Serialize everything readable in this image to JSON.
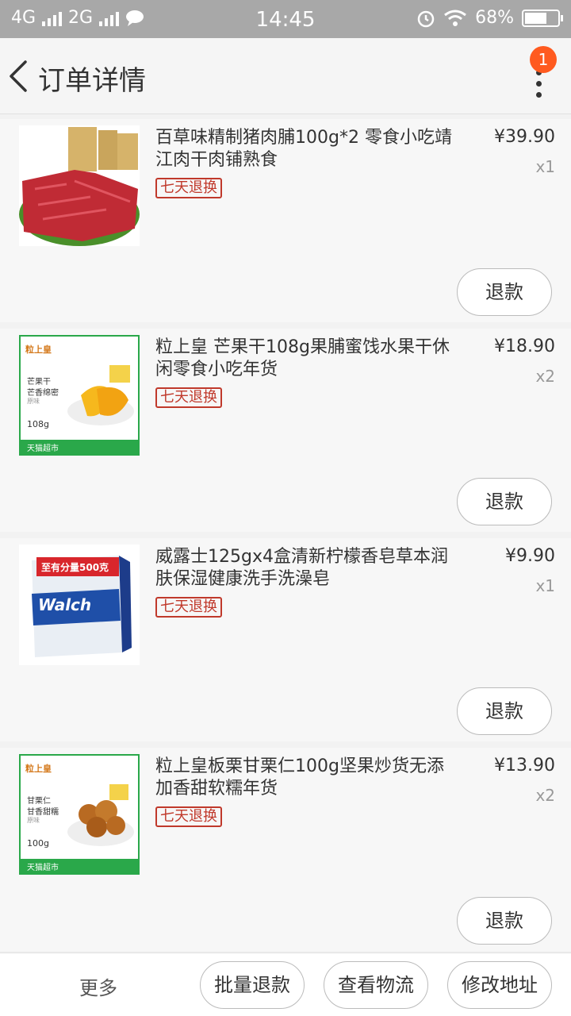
{
  "status_bar": {
    "network1": "4G",
    "network2": "2G",
    "time": "14:45",
    "battery": "68%",
    "battery_level": 0.68
  },
  "header": {
    "title": "订单详情",
    "badge_count": "1"
  },
  "items": [
    {
      "name": "百草味精制猪肉脯100g*2 零食小吃靖江肉干肉铺熟食",
      "tag": "七天退换",
      "price": "¥39.90",
      "qty": "x1",
      "refund": "退款"
    },
    {
      "name": "粒上皇 芒果干108g果脯蜜饯水果干休闲零食小吃年货",
      "tag": "七天退换",
      "price": "¥18.90",
      "qty": "x2",
      "refund": "退款",
      "thumb_brand": "粒上皇",
      "thumb_line1": "芒果干",
      "thumb_line2": "芒香绵密",
      "thumb_line3": "原味",
      "thumb_weight": "108g",
      "thumb_footer": "天猫超市"
    },
    {
      "name": "威露士125gx4盒清新柠檬香皂草本润肤保湿健康洗手洗澡皂",
      "tag": "七天退换",
      "price": "¥9.90",
      "qty": "x1",
      "refund": "退款",
      "thumb_promo": "至有分量500克",
      "thumb_brand": "Walch"
    },
    {
      "name": "粒上皇板栗甘栗仁100g坚果炒货无添加香甜软糯年货",
      "tag": "七天退换",
      "price": "¥13.90",
      "qty": "x2",
      "refund": "退款",
      "thumb_brand": "粒上皇",
      "thumb_line1": "甘栗仁",
      "thumb_line2": "甘香甜糯",
      "thumb_line3": "原味",
      "thumb_weight": "100g",
      "thumb_footer": "天猫超市"
    }
  ],
  "bottom_bar": {
    "more": "更多",
    "batch_refund": "批量退款",
    "view_logistics": "查看物流",
    "change_address": "修改地址"
  },
  "colors": {
    "accent": "#ff5a1f",
    "tag_red": "#c0392b",
    "thumb_green": "#2aa84a"
  }
}
